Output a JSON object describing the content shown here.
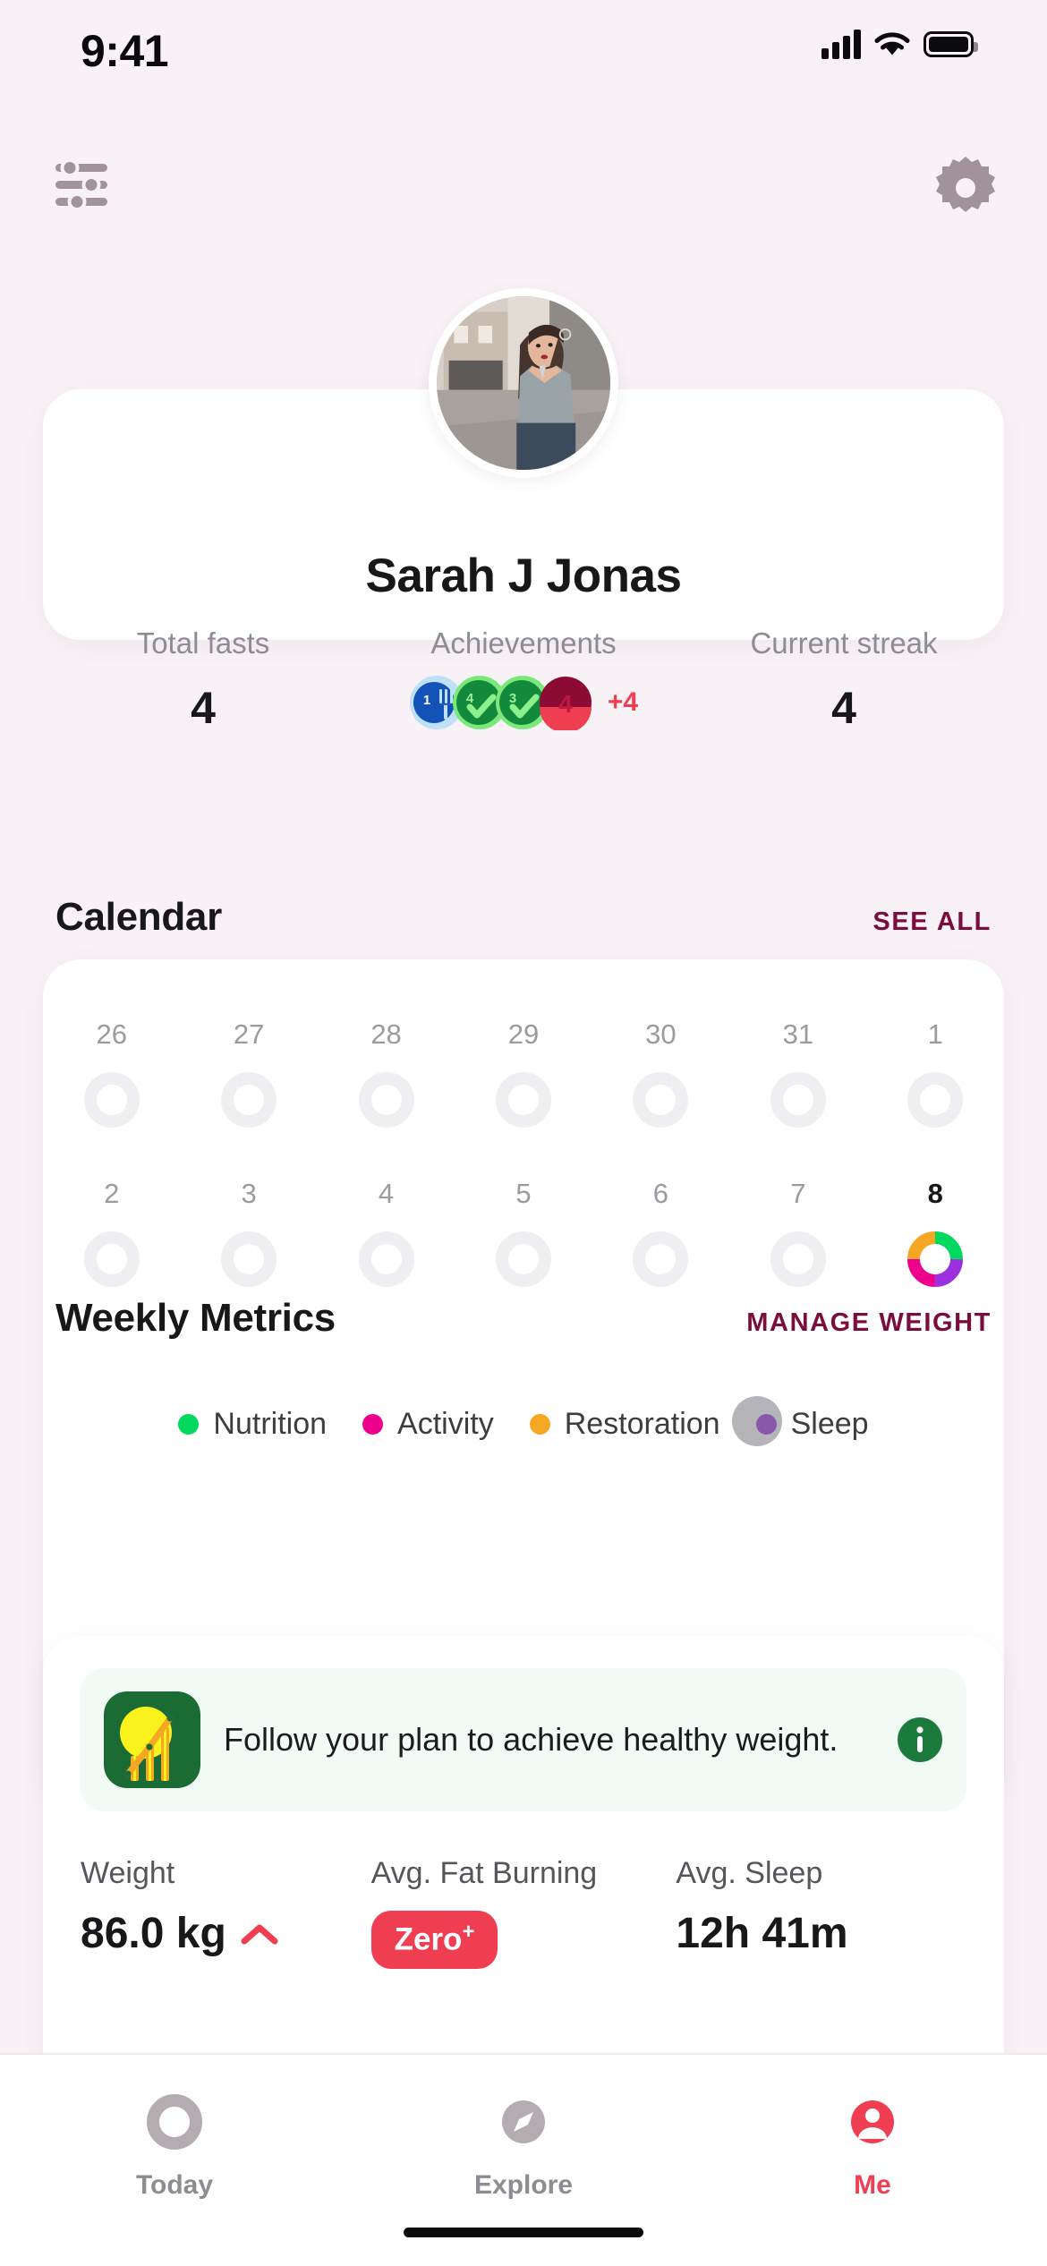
{
  "status_bar": {
    "time": "9:41",
    "cellular": "cellular-bars-icon",
    "wifi": "wifi-icon",
    "battery": "battery-full-icon"
  },
  "top_bar": {
    "left_icon": "sliders-filter-icon",
    "right_icon": "gear-icon"
  },
  "profile": {
    "avatar": "user-avatar-photo",
    "name": "Sarah J Jonas",
    "stats": [
      {
        "label": "Total fasts",
        "value": "4"
      },
      {
        "label": "Achievements",
        "value": ""
      },
      {
        "label": "Current streak",
        "value": "4"
      }
    ],
    "achievements": [
      {
        "name": "fork-badge",
        "number": "1",
        "color": "#1353B8",
        "ring": "#BFE0F7",
        "glyph": "fork"
      },
      {
        "name": "check-badge-4",
        "number": "4",
        "color": "#13893B",
        "ring": "#7CE87C",
        "glyph": "check"
      },
      {
        "name": "check-badge-3",
        "number": "3",
        "color": "#13893B",
        "ring": "#7CE87C",
        "glyph": "check"
      },
      {
        "name": "streak-badge-4",
        "number": "4",
        "color": "#8C0B35",
        "ring": "#EF3E52",
        "glyph": "split"
      }
    ],
    "achievements_more": "+4",
    "more_color": "#EF3E52"
  },
  "calendar": {
    "title": "Calendar",
    "see_all": "SEE ALL",
    "see_all_color": "#7B0D3C",
    "week1": [
      "26",
      "27",
      "28",
      "29",
      "30",
      "31",
      "1"
    ],
    "week2": [
      "2",
      "3",
      "4",
      "5",
      "6",
      "7",
      "8"
    ],
    "today": "8",
    "today_segments": [
      {
        "label": "Nutrition",
        "color": "#00D95F",
        "value": 25
      },
      {
        "label": "Sleep",
        "color": "#9B30E0",
        "value": 25
      },
      {
        "label": "Activity",
        "color": "#EC008C",
        "value": 25
      },
      {
        "label": "Restoration",
        "color": "#F5A623",
        "value": 25
      }
    ],
    "legend": [
      {
        "label": "Nutrition",
        "color": "#00D95F"
      },
      {
        "label": "Activity",
        "color": "#EC008C"
      },
      {
        "label": "Restoration",
        "color": "#F5A623"
      },
      {
        "label": "Sleep",
        "color": "#9B30E0"
      }
    ]
  },
  "weekly_metrics": {
    "title": "Weekly Metrics",
    "manage_link": "MANAGE WEIGHT",
    "manage_link_color": "#7B0D3C",
    "banner": {
      "icon": "growth-chart-sun-icon",
      "text": "Follow your plan to achieve healthy weight.",
      "info_icon": "info-circle-icon",
      "info_color": "#1B7A3C",
      "background": "#F2FAF5"
    },
    "metrics": [
      {
        "label": "Weight",
        "value": "86.0 kg",
        "trend": "up-chevron-icon",
        "trend_color": "#EF3E52"
      },
      {
        "label": "Avg. Fat Burning",
        "badge": "Zero",
        "badge_sup": "+",
        "badge_color": "#EF3E52"
      },
      {
        "label": "Avg. Sleep",
        "value": "12h 41m"
      }
    ]
  },
  "tab_bar": {
    "items": [
      {
        "label": "Today",
        "icon": "ring-today-icon",
        "active": false
      },
      {
        "label": "Explore",
        "icon": "compass-icon",
        "active": false
      },
      {
        "label": "Me",
        "icon": "person-circle-icon",
        "active": true
      }
    ],
    "active_color": "#EF3E52",
    "inactive_color": "#B3ACB0"
  }
}
